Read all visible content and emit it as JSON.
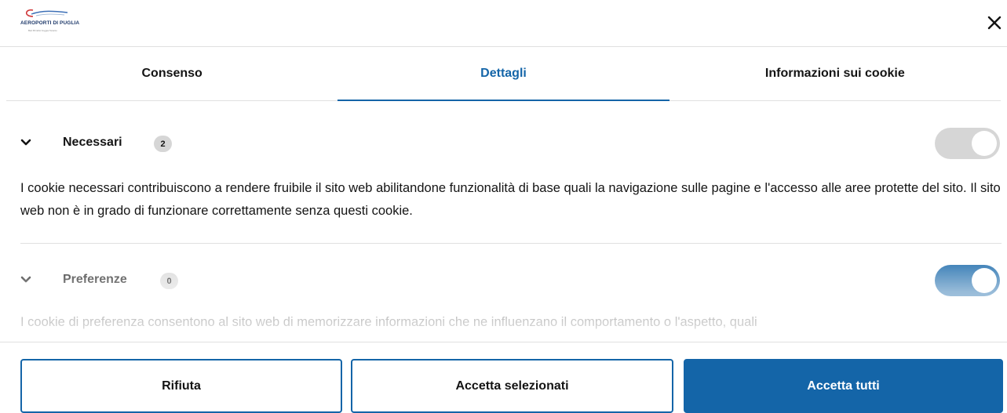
{
  "brand": {
    "logo_text": "AEROPORTI DI PUGLIA",
    "logo_tagline": "Bari  Brindisi  Foggia  Taranto"
  },
  "header": {
    "close_icon": "close-icon"
  },
  "tabs": [
    {
      "label": "Consenso",
      "active": false
    },
    {
      "label": "Dettagli",
      "active": true
    },
    {
      "label": "Informazioni sui cookie",
      "active": false
    }
  ],
  "sections": [
    {
      "title": "Necessari",
      "count": "2",
      "toggle_state": "on-disabled",
      "description": "I cookie necessari contribuiscono a rendere fruibile il sito web abilitandone funzionalità di base quali la navigazione sulle pagine e l'accesso alle aree protette del sito. Il sito web non è in grado di funzionare correttamente senza questi cookie."
    },
    {
      "title": "Preferenze",
      "count": "0",
      "toggle_state": "on",
      "description": "I cookie di preferenza consentono al sito web di memorizzare informazioni che ne influenzano il comportamento o l'aspetto, quali"
    }
  ],
  "buttons": {
    "reject": "Rifiuta",
    "accept_selected": "Accetta selezionati",
    "accept_all": "Accetta tutti"
  },
  "colors": {
    "accent": "#1465a8",
    "toggle_disabled": "#d6d6d6",
    "divider": "#e0e0e0"
  }
}
